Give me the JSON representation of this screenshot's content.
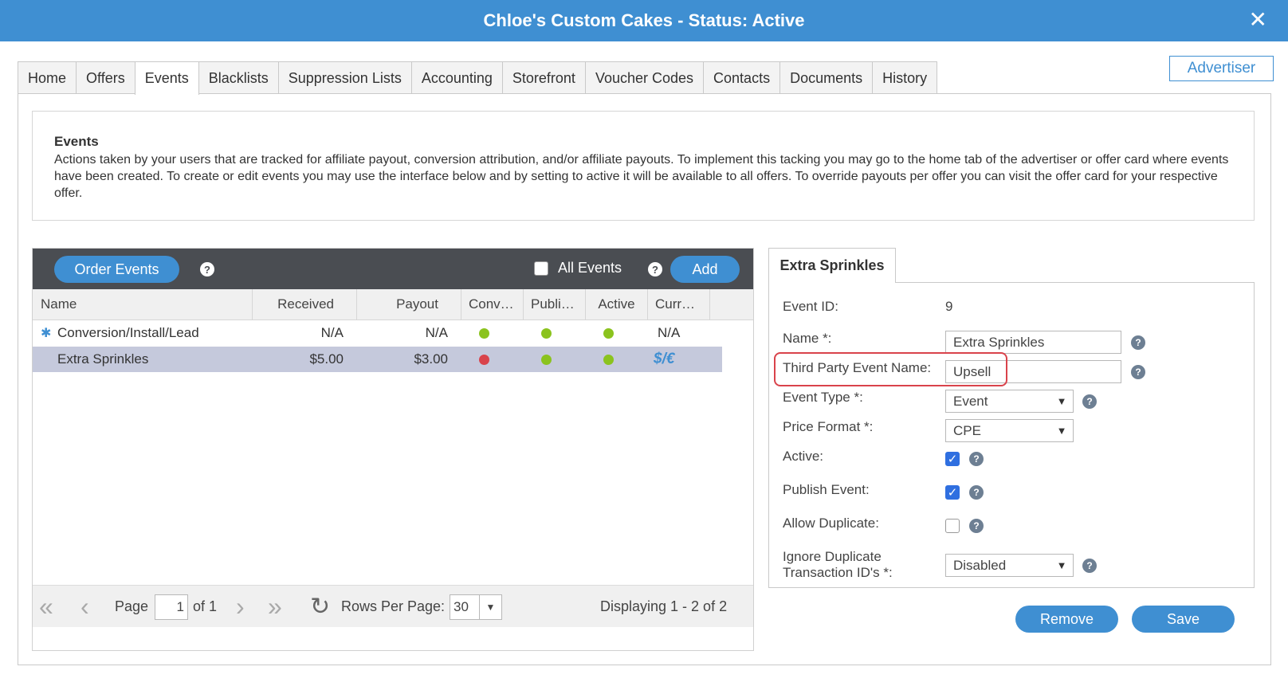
{
  "window": {
    "title": "Chloe's Custom Cakes - Status: Active",
    "close_label": "✕"
  },
  "tabs": [
    {
      "label": "Home"
    },
    {
      "label": "Offers"
    },
    {
      "label": "Events"
    },
    {
      "label": "Blacklists"
    },
    {
      "label": "Suppression Lists"
    },
    {
      "label": "Accounting"
    },
    {
      "label": "Storefront"
    },
    {
      "label": "Voucher Codes"
    },
    {
      "label": "Contacts"
    },
    {
      "label": "Documents"
    },
    {
      "label": "History"
    }
  ],
  "active_tab": "Events",
  "advertiser_label": "Advertiser",
  "description": {
    "title": "Events",
    "text": "Actions taken by your users that are tracked for affiliate payout, conversion attribution, and/or affiliate payouts. To implement this tacking you may go to the home tab of the advertiser or offer card where events have been created. To create or edit events you may use the interface below and by setting to active it will be available to all offers. To override payouts per offer you can visit the offer card for your respective offer."
  },
  "grid": {
    "order_events_label": "Order Events",
    "all_events_label": "All Events",
    "add_label": "Add",
    "help_glyph": "?",
    "columns": [
      "Name",
      "Received",
      "Payout",
      "Conv…",
      "Publi…",
      "Active",
      "Curr…"
    ],
    "rows": [
      {
        "name": "Conversion/Install/Lead",
        "received": "N/A",
        "payout": "N/A",
        "conv": "green",
        "publish": "green",
        "active": "green",
        "currency": "N/A",
        "base_icon": "✱"
      },
      {
        "name": "Extra Sprinkles",
        "received": "$5.00",
        "payout": "$3.00",
        "conv": "red",
        "publish": "green",
        "active": "green",
        "currency": "$/€"
      }
    ],
    "pager": {
      "page_label": "Page",
      "page_value": "1",
      "of_label": "of 1",
      "rows_per_page_label": "Rows Per Page:",
      "rows_per_page_value": "30",
      "displaying": "Displaying 1 - 2 of 2"
    }
  },
  "detail": {
    "tab_label": "Extra Sprinkles",
    "event_id_label": "Event ID:",
    "event_id_value": "9",
    "name_label": "Name *:",
    "name_value": "Extra Sprinkles",
    "third_party_label": "Third Party Event Name:",
    "third_party_value": "Upsell",
    "event_type_label": "Event Type *:",
    "event_type_value": "Event",
    "price_format_label": "Price Format *:",
    "price_format_value": "CPE",
    "active_label": "Active:",
    "active_checked": true,
    "publish_label": "Publish Event:",
    "publish_checked": true,
    "allow_dup_label": "Allow Duplicate:",
    "allow_dup_checked": false,
    "ignore_dup_label_1": "Ignore Duplicate",
    "ignore_dup_label_2": "Transaction ID's *:",
    "ignore_dup_value": "Disabled",
    "remove_label": "Remove",
    "save_label": "Save"
  },
  "colors": {
    "accent": "#3f8fd2",
    "toolbar": "#4a4d52",
    "selected_row": "#c5c9dc",
    "dot_green": "#8bc31e",
    "dot_red": "#d9434b"
  }
}
